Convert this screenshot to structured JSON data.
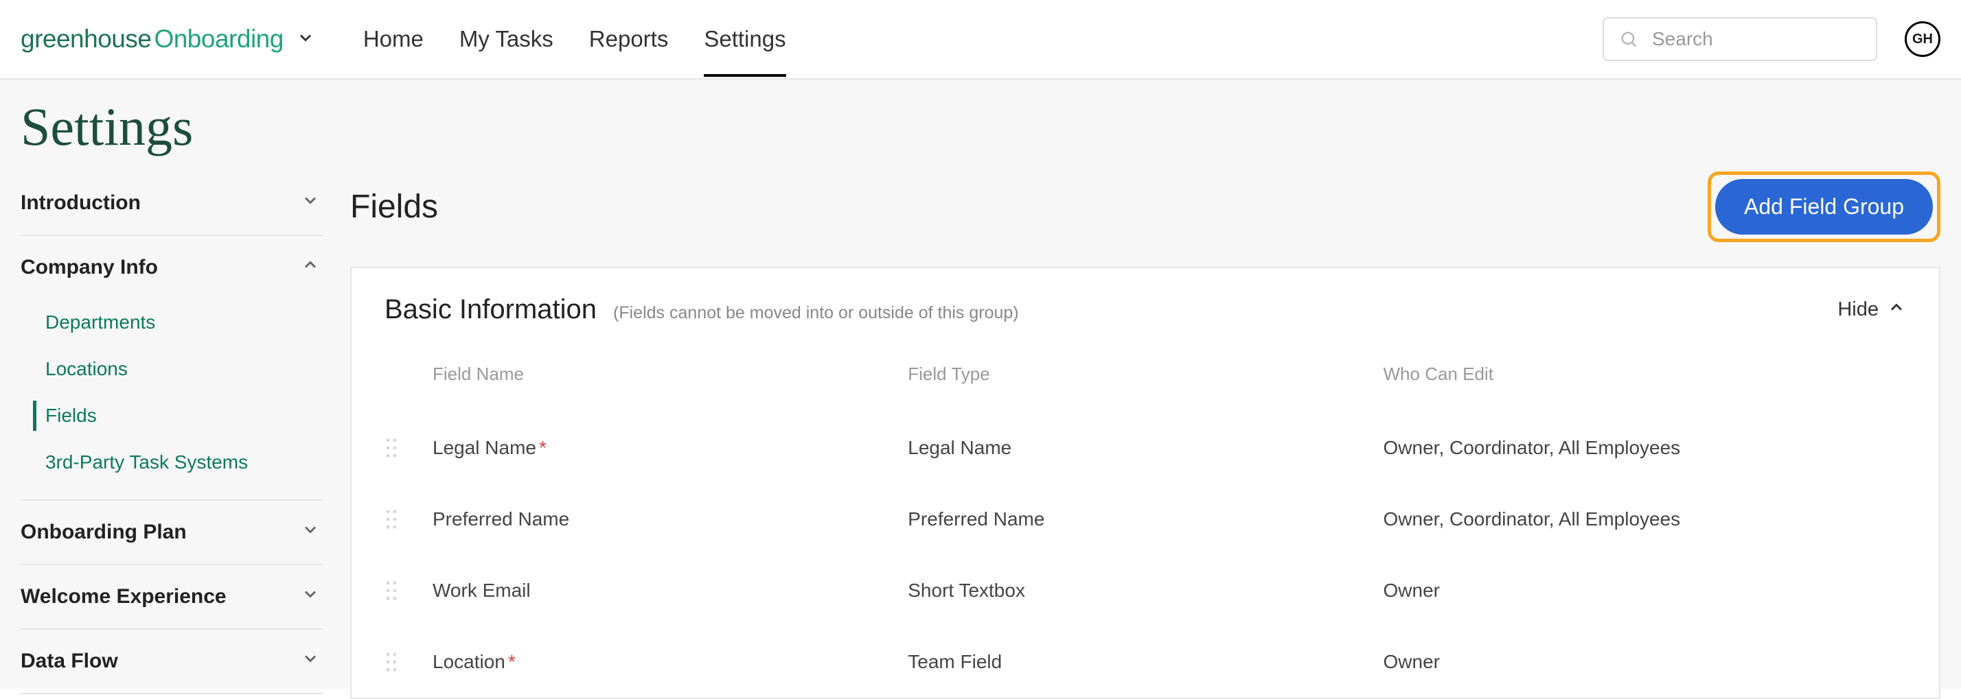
{
  "brand": {
    "name1": "greenhouse",
    "name2": "Onboarding"
  },
  "nav": {
    "items": [
      {
        "label": "Home"
      },
      {
        "label": "My Tasks"
      },
      {
        "label": "Reports"
      },
      {
        "label": "Settings"
      }
    ],
    "activeIndex": 3
  },
  "search": {
    "placeholder": "Search"
  },
  "avatar": {
    "initials": "GH"
  },
  "page": {
    "title": "Settings"
  },
  "sidebar": {
    "sections": [
      {
        "label": "Introduction",
        "expanded": false
      },
      {
        "label": "Company Info",
        "expanded": true,
        "items": [
          {
            "label": "Departments"
          },
          {
            "label": "Locations"
          },
          {
            "label": "Fields"
          },
          {
            "label": "3rd-Party Task Systems"
          }
        ],
        "activeItemIndex": 2
      },
      {
        "label": "Onboarding Plan",
        "expanded": false
      },
      {
        "label": "Welcome Experience",
        "expanded": false
      },
      {
        "label": "Data Flow",
        "expanded": false
      }
    ]
  },
  "content": {
    "title": "Fields",
    "addButton": "Add Field Group"
  },
  "fieldGroup": {
    "title": "Basic Information",
    "note": "(Fields cannot be moved into or outside of this group)",
    "hideLabel": "Hide",
    "columns": {
      "name": "Field Name",
      "type": "Field Type",
      "editors": "Who Can Edit"
    },
    "rows": [
      {
        "name": "Legal Name",
        "required": true,
        "type": "Legal Name",
        "editors": "Owner, Coordinator, All Employees"
      },
      {
        "name": "Preferred Name",
        "required": false,
        "type": "Preferred Name",
        "editors": "Owner, Coordinator, All Employees"
      },
      {
        "name": "Work Email",
        "required": false,
        "type": "Short Textbox",
        "editors": "Owner"
      },
      {
        "name": "Location",
        "required": true,
        "type": "Team Field",
        "editors": "Owner"
      }
    ]
  }
}
